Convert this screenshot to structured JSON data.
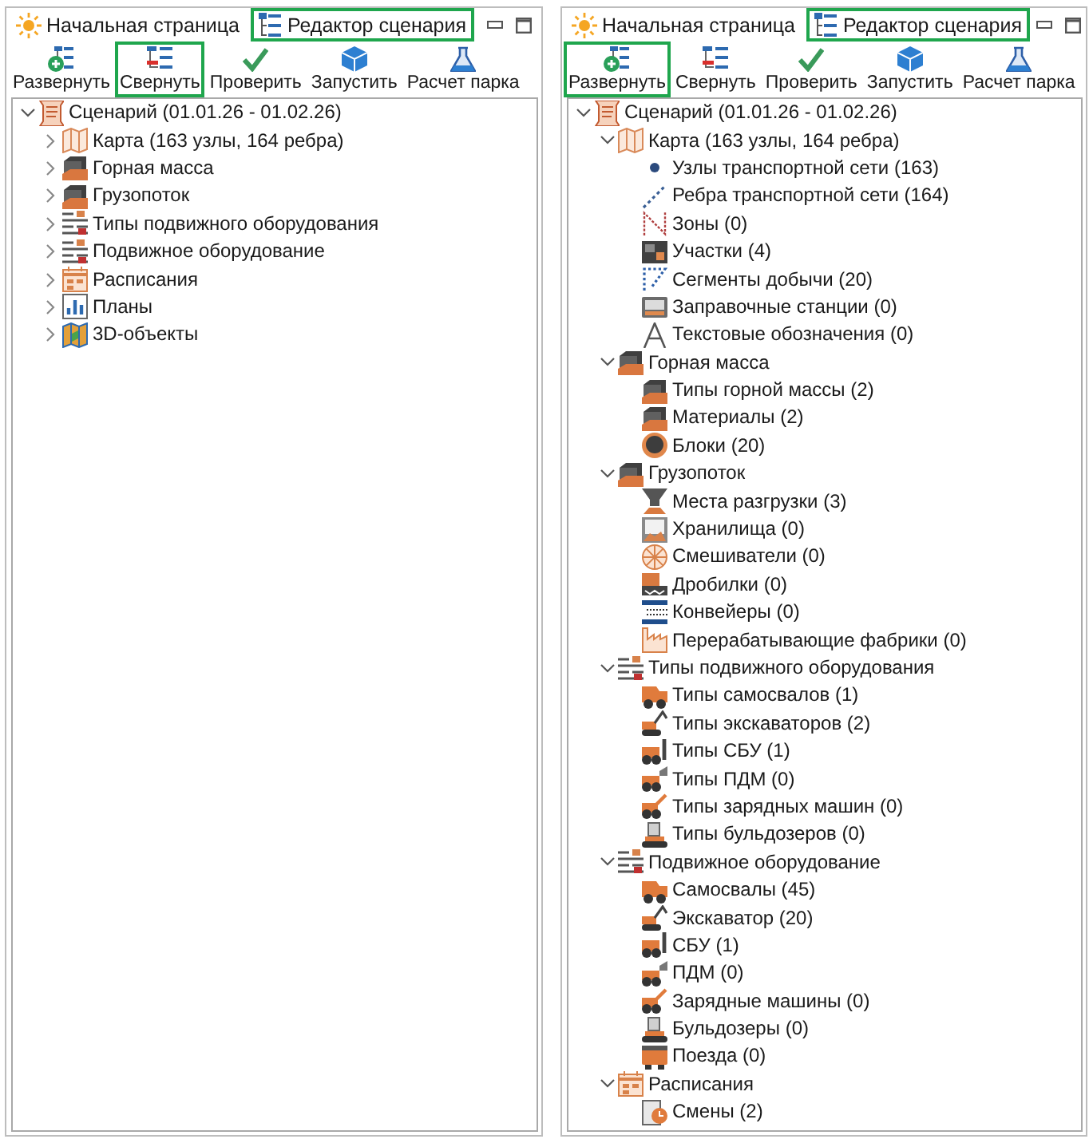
{
  "panels": [
    {
      "tabs": [
        {
          "label": "Начальная страница",
          "kind": "home",
          "highlighted": false
        },
        {
          "label": "Редактор сценария",
          "kind": "editor",
          "highlighted": true
        }
      ],
      "toolbar": [
        {
          "label": "Развернуть",
          "kind": "expand",
          "highlighted": false
        },
        {
          "label": "Свернуть",
          "kind": "collapse",
          "highlighted": true
        },
        {
          "label": "Проверить",
          "kind": "check",
          "highlighted": false
        },
        {
          "label": "Запустить",
          "kind": "run",
          "highlighted": false
        },
        {
          "label": "Расчет парка",
          "kind": "calc",
          "highlighted": false
        }
      ],
      "tree": [
        {
          "label": "Сценарий (01.01.26 - 01.02.26)",
          "kind": "scenario",
          "expanded": true,
          "children": [
            {
              "label": "Карта (163 узлы, 164 ребра)",
              "kind": "map",
              "expanded": false
            },
            {
              "label": "Горная масса",
              "kind": "rock",
              "expanded": false
            },
            {
              "label": "Грузопоток",
              "kind": "rock",
              "expanded": false
            },
            {
              "label": "Типы подвижного оборудования",
              "kind": "fleet",
              "expanded": false
            },
            {
              "label": "Подвижное оборудование",
              "kind": "fleet",
              "expanded": false
            },
            {
              "label": "Расписания",
              "kind": "schedule",
              "expanded": false
            },
            {
              "label": "Планы",
              "kind": "plans",
              "expanded": false
            },
            {
              "label": "3D-объекты",
              "kind": "objects",
              "expanded": false
            }
          ]
        }
      ]
    },
    {
      "tabs": [
        {
          "label": "Начальная страница",
          "kind": "home",
          "highlighted": false
        },
        {
          "label": "Редактор сценария",
          "kind": "editor",
          "highlighted": true
        }
      ],
      "toolbar": [
        {
          "label": "Развернуть",
          "kind": "expand",
          "highlighted": true
        },
        {
          "label": "Свернуть",
          "kind": "collapse",
          "highlighted": false
        },
        {
          "label": "Проверить",
          "kind": "check",
          "highlighted": false
        },
        {
          "label": "Запустить",
          "kind": "run",
          "highlighted": false
        },
        {
          "label": "Расчет парка",
          "kind": "calc",
          "highlighted": false
        }
      ],
      "tree": [
        {
          "label": "Сценарий (01.01.26 - 01.02.26)",
          "kind": "scenario",
          "expanded": true,
          "children": [
            {
              "label": "Карта (163 узлы, 164 ребра)",
              "kind": "map",
              "expanded": true,
              "children": [
                {
                  "label": "Узлы транспортной сети (163)",
                  "kind": "nodes"
                },
                {
                  "label": "Ребра транспортной сети (164)",
                  "kind": "edges"
                },
                {
                  "label": "Зоны (0)",
                  "kind": "zones"
                },
                {
                  "label": "Участки (4)",
                  "kind": "areas"
                },
                {
                  "label": "Сегменты добычи (20)",
                  "kind": "segments"
                },
                {
                  "label": "Заправочные станции (0)",
                  "kind": "stations"
                },
                {
                  "label": "Текстовые обозначения (0)",
                  "kind": "labels"
                }
              ]
            },
            {
              "label": "Горная масса",
              "kind": "rock",
              "expanded": true,
              "children": [
                {
                  "label": "Типы горной массы (2)",
                  "kind": "rock"
                },
                {
                  "label": "Материалы (2)",
                  "kind": "rock"
                },
                {
                  "label": "Блоки (20)",
                  "kind": "blocks"
                }
              ]
            },
            {
              "label": "Грузопоток",
              "kind": "rock",
              "expanded": true,
              "children": [
                {
                  "label": "Места разгрузки (3)",
                  "kind": "unloading"
                },
                {
                  "label": "Хранилища (0)",
                  "kind": "storage"
                },
                {
                  "label": "Смешиватели (0)",
                  "kind": "mixers"
                },
                {
                  "label": "Дробилки (0)",
                  "kind": "crushers"
                },
                {
                  "label": "Конвейеры (0)",
                  "kind": "conveyors"
                },
                {
                  "label": "Перерабатывающие фабрики (0)",
                  "kind": "plants"
                }
              ]
            },
            {
              "label": "Типы подвижного оборудования",
              "kind": "fleet",
              "expanded": true,
              "children": [
                {
                  "label": "Типы самосвалов (1)",
                  "kind": "dumptrucks"
                },
                {
                  "label": "Типы экскаваторов (2)",
                  "kind": "excavators"
                },
                {
                  "label": "Типы СБУ (1)",
                  "kind": "drills"
                },
                {
                  "label": "Типы ПДМ (0)",
                  "kind": "loaders"
                },
                {
                  "label": "Типы зарядных машин (0)",
                  "kind": "chargers"
                },
                {
                  "label": "Типы бульдозеров (0)",
                  "kind": "bulldozers"
                }
              ]
            },
            {
              "label": "Подвижное оборудование",
              "kind": "fleet",
              "expanded": true,
              "children": [
                {
                  "label": "Самосвалы (45)",
                  "kind": "dumptrucks"
                },
                {
                  "label": "Экскаватор (20)",
                  "kind": "excavators"
                },
                {
                  "label": "СБУ (1)",
                  "kind": "drills"
                },
                {
                  "label": "ПДМ (0)",
                  "kind": "loaders"
                },
                {
                  "label": "Зарядные машины (0)",
                  "kind": "chargers"
                },
                {
                  "label": "Бульдозеры (0)",
                  "kind": "bulldozers"
                },
                {
                  "label": "Поезда (0)",
                  "kind": "trains"
                }
              ]
            },
            {
              "label": "Расписания",
              "kind": "schedule",
              "expanded": true,
              "children": [
                {
                  "label": "Смены (2)",
                  "kind": "shifts"
                }
              ]
            }
          ]
        }
      ]
    }
  ]
}
